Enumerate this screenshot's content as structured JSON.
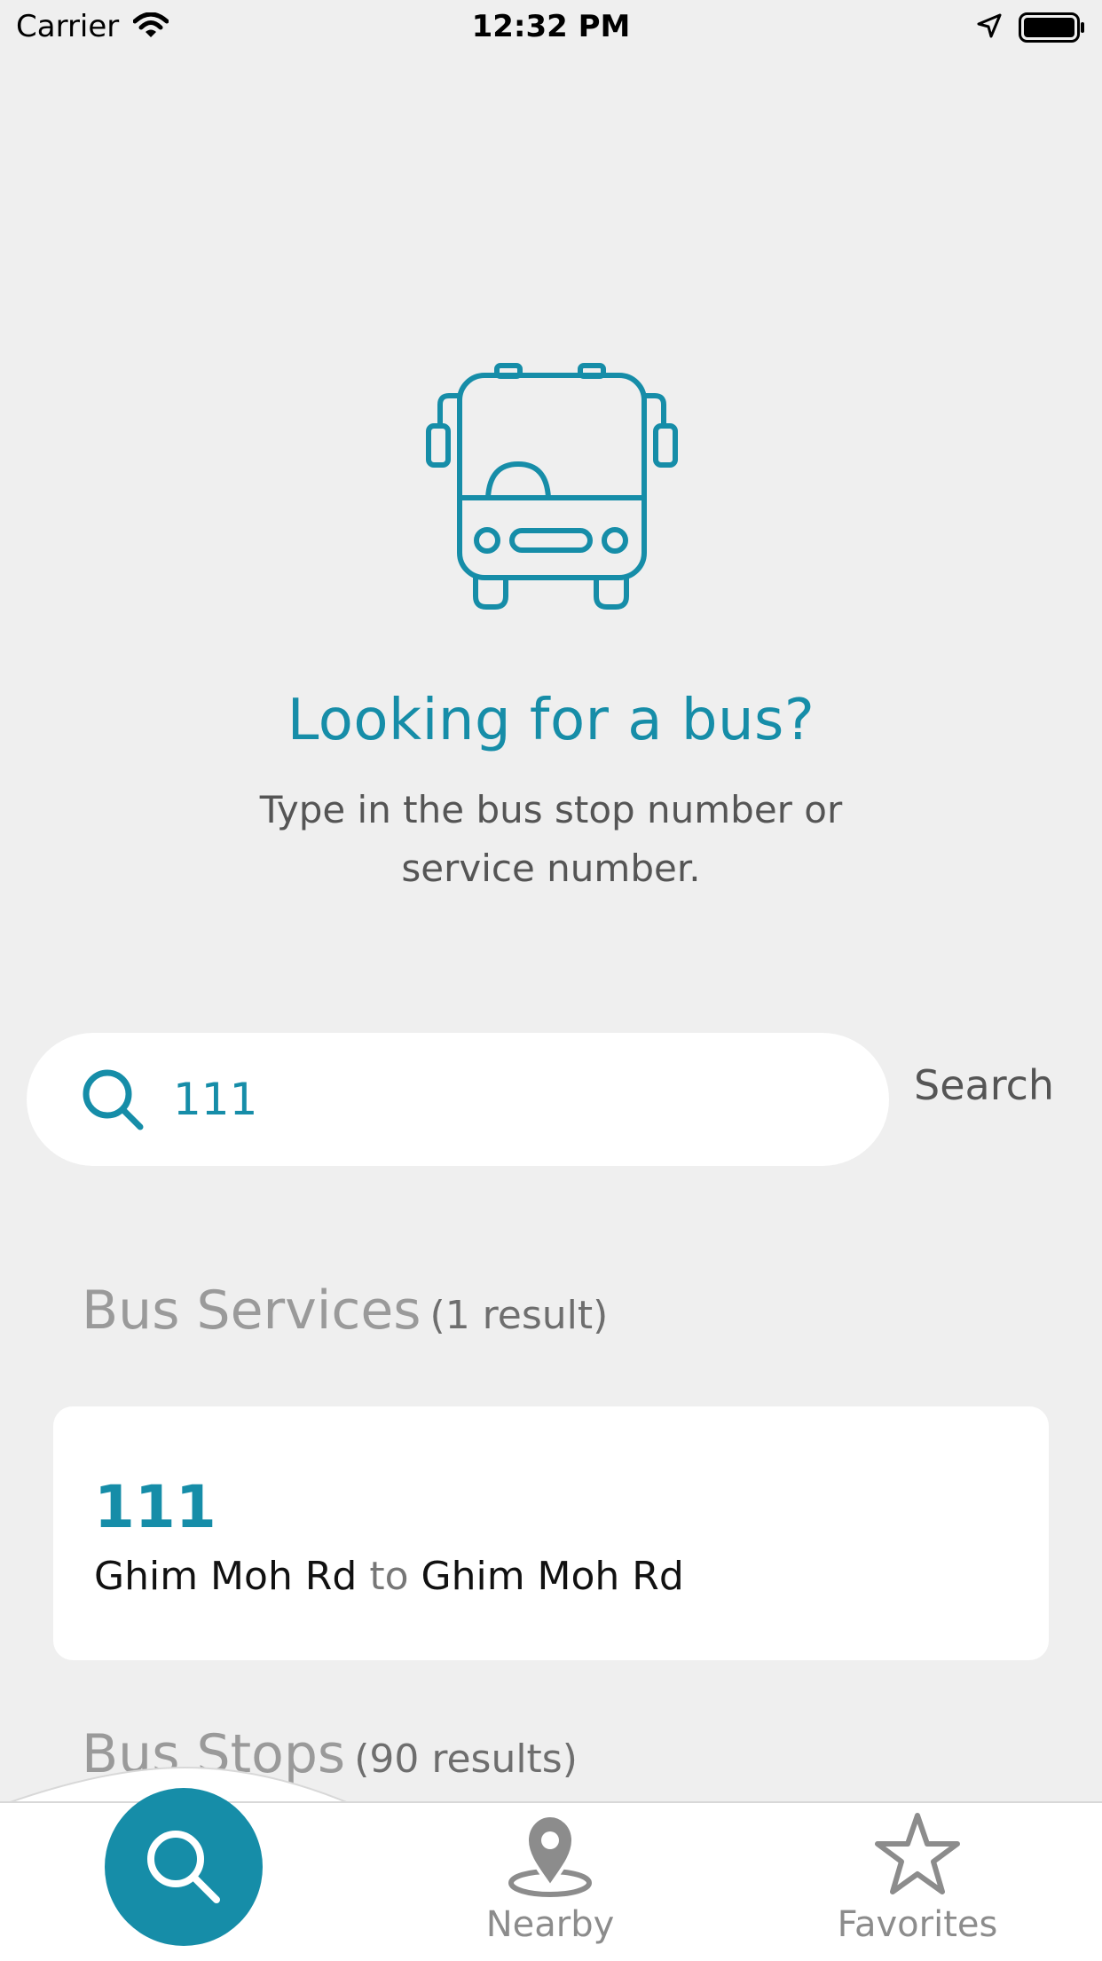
{
  "status_bar": {
    "carrier": "Carrier",
    "time": "12:32 PM"
  },
  "hero": {
    "icon": "bus-icon",
    "title": "Looking for a bus?",
    "subtitle": "Type in the bus stop number or service number."
  },
  "search": {
    "value": "111",
    "button_label": "Search"
  },
  "bus_services": {
    "title": "Bus Services",
    "count": "(1 result)",
    "items": [
      {
        "number": "111",
        "from": "Ghim Moh Rd",
        "connector": "to",
        "to": "Ghim Moh Rd"
      }
    ]
  },
  "bus_stops": {
    "title": "Bus Stops",
    "count": "(90 results)"
  },
  "tab_bar": {
    "tabs": [
      {
        "id": "search",
        "label": "",
        "icon": "search-icon",
        "active": true
      },
      {
        "id": "nearby",
        "label": "Nearby",
        "icon": "map-pin-icon",
        "active": false
      },
      {
        "id": "favorites",
        "label": "Favorites",
        "icon": "star-icon",
        "active": false
      }
    ]
  },
  "colors": {
    "accent": "#168da8",
    "background": "#efefef",
    "inactive": "#8c8c8c"
  }
}
